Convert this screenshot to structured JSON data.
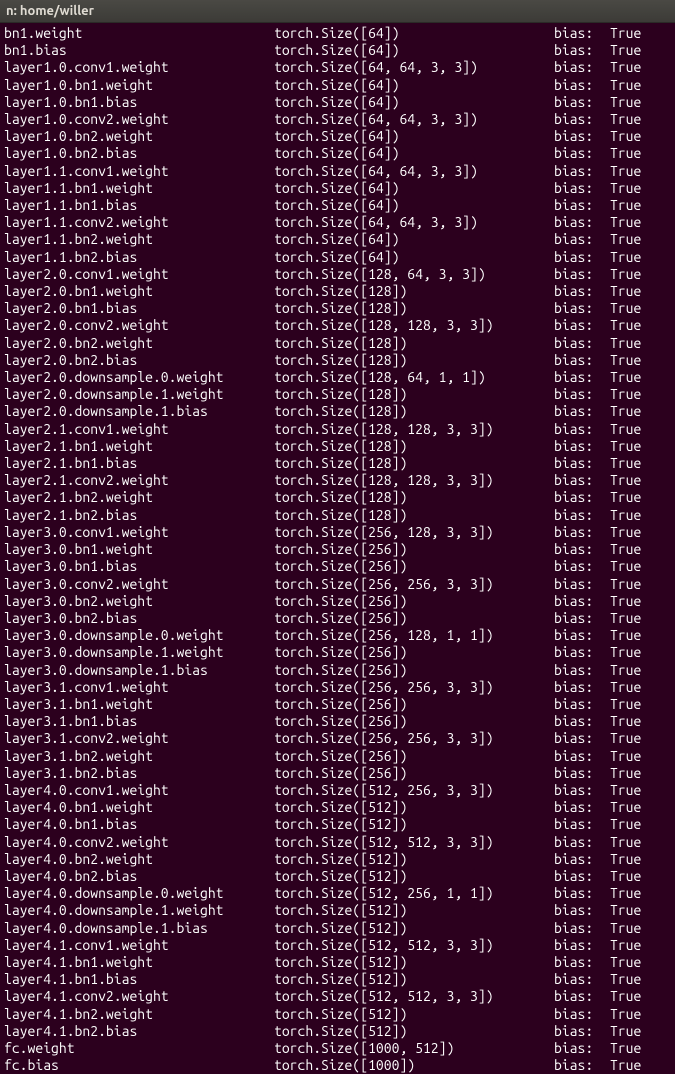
{
  "titlebar": "n: home/willer",
  "rows": [
    {
      "name": "bn1.weight",
      "size": "torch.Size([64])",
      "bias_label": "bias:",
      "bias_value": "True"
    },
    {
      "name": "bn1.bias",
      "size": "torch.Size([64])",
      "bias_label": "bias:",
      "bias_value": "True"
    },
    {
      "name": "layer1.0.conv1.weight",
      "size": "torch.Size([64, 64, 3, 3])",
      "bias_label": "bias:",
      "bias_value": "True"
    },
    {
      "name": "layer1.0.bn1.weight",
      "size": "torch.Size([64])",
      "bias_label": "bias:",
      "bias_value": "True"
    },
    {
      "name": "layer1.0.bn1.bias",
      "size": "torch.Size([64])",
      "bias_label": "bias:",
      "bias_value": "True"
    },
    {
      "name": "layer1.0.conv2.weight",
      "size": "torch.Size([64, 64, 3, 3])",
      "bias_label": "bias:",
      "bias_value": "True"
    },
    {
      "name": "layer1.0.bn2.weight",
      "size": "torch.Size([64])",
      "bias_label": "bias:",
      "bias_value": "True"
    },
    {
      "name": "layer1.0.bn2.bias",
      "size": "torch.Size([64])",
      "bias_label": "bias:",
      "bias_value": "True"
    },
    {
      "name": "layer1.1.conv1.weight",
      "size": "torch.Size([64, 64, 3, 3])",
      "bias_label": "bias:",
      "bias_value": "True"
    },
    {
      "name": "layer1.1.bn1.weight",
      "size": "torch.Size([64])",
      "bias_label": "bias:",
      "bias_value": "True"
    },
    {
      "name": "layer1.1.bn1.bias",
      "size": "torch.Size([64])",
      "bias_label": "bias:",
      "bias_value": "True"
    },
    {
      "name": "layer1.1.conv2.weight",
      "size": "torch.Size([64, 64, 3, 3])",
      "bias_label": "bias:",
      "bias_value": "True"
    },
    {
      "name": "layer1.1.bn2.weight",
      "size": "torch.Size([64])",
      "bias_label": "bias:",
      "bias_value": "True"
    },
    {
      "name": "layer1.1.bn2.bias",
      "size": "torch.Size([64])",
      "bias_label": "bias:",
      "bias_value": "True"
    },
    {
      "name": "layer2.0.conv1.weight",
      "size": "torch.Size([128, 64, 3, 3])",
      "bias_label": "bias:",
      "bias_value": "True"
    },
    {
      "name": "layer2.0.bn1.weight",
      "size": "torch.Size([128])",
      "bias_label": "bias:",
      "bias_value": "True"
    },
    {
      "name": "layer2.0.bn1.bias",
      "size": "torch.Size([128])",
      "bias_label": "bias:",
      "bias_value": "True"
    },
    {
      "name": "layer2.0.conv2.weight",
      "size": "torch.Size([128, 128, 3, 3])",
      "bias_label": "bias:",
      "bias_value": "True"
    },
    {
      "name": "layer2.0.bn2.weight",
      "size": "torch.Size([128])",
      "bias_label": "bias:",
      "bias_value": "True"
    },
    {
      "name": "layer2.0.bn2.bias",
      "size": "torch.Size([128])",
      "bias_label": "bias:",
      "bias_value": "True"
    },
    {
      "name": "layer2.0.downsample.0.weight",
      "size": "torch.Size([128, 64, 1, 1])",
      "bias_label": "bias:",
      "bias_value": "True"
    },
    {
      "name": "layer2.0.downsample.1.weight",
      "size": "torch.Size([128])",
      "bias_label": "bias:",
      "bias_value": "True"
    },
    {
      "name": "layer2.0.downsample.1.bias",
      "size": "torch.Size([128])",
      "bias_label": "bias:",
      "bias_value": "True"
    },
    {
      "name": "layer2.1.conv1.weight",
      "size": "torch.Size([128, 128, 3, 3])",
      "bias_label": "bias:",
      "bias_value": "True"
    },
    {
      "name": "layer2.1.bn1.weight",
      "size": "torch.Size([128])",
      "bias_label": "bias:",
      "bias_value": "True"
    },
    {
      "name": "layer2.1.bn1.bias",
      "size": "torch.Size([128])",
      "bias_label": "bias:",
      "bias_value": "True"
    },
    {
      "name": "layer2.1.conv2.weight",
      "size": "torch.Size([128, 128, 3, 3])",
      "bias_label": "bias:",
      "bias_value": "True"
    },
    {
      "name": "layer2.1.bn2.weight",
      "size": "torch.Size([128])",
      "bias_label": "bias:",
      "bias_value": "True"
    },
    {
      "name": "layer2.1.bn2.bias",
      "size": "torch.Size([128])",
      "bias_label": "bias:",
      "bias_value": "True"
    },
    {
      "name": "layer3.0.conv1.weight",
      "size": "torch.Size([256, 128, 3, 3])",
      "bias_label": "bias:",
      "bias_value": "True"
    },
    {
      "name": "layer3.0.bn1.weight",
      "size": "torch.Size([256])",
      "bias_label": "bias:",
      "bias_value": "True"
    },
    {
      "name": "layer3.0.bn1.bias",
      "size": "torch.Size([256])",
      "bias_label": "bias:",
      "bias_value": "True"
    },
    {
      "name": "layer3.0.conv2.weight",
      "size": "torch.Size([256, 256, 3, 3])",
      "bias_label": "bias:",
      "bias_value": "True"
    },
    {
      "name": "layer3.0.bn2.weight",
      "size": "torch.Size([256])",
      "bias_label": "bias:",
      "bias_value": "True"
    },
    {
      "name": "layer3.0.bn2.bias",
      "size": "torch.Size([256])",
      "bias_label": "bias:",
      "bias_value": "True"
    },
    {
      "name": "layer3.0.downsample.0.weight",
      "size": "torch.Size([256, 128, 1, 1])",
      "bias_label": "bias:",
      "bias_value": "True"
    },
    {
      "name": "layer3.0.downsample.1.weight",
      "size": "torch.Size([256])",
      "bias_label": "bias:",
      "bias_value": "True"
    },
    {
      "name": "layer3.0.downsample.1.bias",
      "size": "torch.Size([256])",
      "bias_label": "bias:",
      "bias_value": "True"
    },
    {
      "name": "layer3.1.conv1.weight",
      "size": "torch.Size([256, 256, 3, 3])",
      "bias_label": "bias:",
      "bias_value": "True"
    },
    {
      "name": "layer3.1.bn1.weight",
      "size": "torch.Size([256])",
      "bias_label": "bias:",
      "bias_value": "True"
    },
    {
      "name": "layer3.1.bn1.bias",
      "size": "torch.Size([256])",
      "bias_label": "bias:",
      "bias_value": "True"
    },
    {
      "name": "layer3.1.conv2.weight",
      "size": "torch.Size([256, 256, 3, 3])",
      "bias_label": "bias:",
      "bias_value": "True"
    },
    {
      "name": "layer3.1.bn2.weight",
      "size": "torch.Size([256])",
      "bias_label": "bias:",
      "bias_value": "True"
    },
    {
      "name": "layer3.1.bn2.bias",
      "size": "torch.Size([256])",
      "bias_label": "bias:",
      "bias_value": "True"
    },
    {
      "name": "layer4.0.conv1.weight",
      "size": "torch.Size([512, 256, 3, 3])",
      "bias_label": "bias:",
      "bias_value": "True"
    },
    {
      "name": "layer4.0.bn1.weight",
      "size": "torch.Size([512])",
      "bias_label": "bias:",
      "bias_value": "True"
    },
    {
      "name": "layer4.0.bn1.bias",
      "size": "torch.Size([512])",
      "bias_label": "bias:",
      "bias_value": "True"
    },
    {
      "name": "layer4.0.conv2.weight",
      "size": "torch.Size([512, 512, 3, 3])",
      "bias_label": "bias:",
      "bias_value": "True"
    },
    {
      "name": "layer4.0.bn2.weight",
      "size": "torch.Size([512])",
      "bias_label": "bias:",
      "bias_value": "True"
    },
    {
      "name": "layer4.0.bn2.bias",
      "size": "torch.Size([512])",
      "bias_label": "bias:",
      "bias_value": "True"
    },
    {
      "name": "layer4.0.downsample.0.weight",
      "size": "torch.Size([512, 256, 1, 1])",
      "bias_label": "bias:",
      "bias_value": "True"
    },
    {
      "name": "layer4.0.downsample.1.weight",
      "size": "torch.Size([512])",
      "bias_label": "bias:",
      "bias_value": "True"
    },
    {
      "name": "layer4.0.downsample.1.bias",
      "size": "torch.Size([512])",
      "bias_label": "bias:",
      "bias_value": "True"
    },
    {
      "name": "layer4.1.conv1.weight",
      "size": "torch.Size([512, 512, 3, 3])",
      "bias_label": "bias:",
      "bias_value": "True"
    },
    {
      "name": "layer4.1.bn1.weight",
      "size": "torch.Size([512])",
      "bias_label": "bias:",
      "bias_value": "True"
    },
    {
      "name": "layer4.1.bn1.bias",
      "size": "torch.Size([512])",
      "bias_label": "bias:",
      "bias_value": "True"
    },
    {
      "name": "layer4.1.conv2.weight",
      "size": "torch.Size([512, 512, 3, 3])",
      "bias_label": "bias:",
      "bias_value": "True"
    },
    {
      "name": "layer4.1.bn2.weight",
      "size": "torch.Size([512])",
      "bias_label": "bias:",
      "bias_value": "True"
    },
    {
      "name": "layer4.1.bn2.bias",
      "size": "torch.Size([512])",
      "bias_label": "bias:",
      "bias_value": "True"
    },
    {
      "name": "fc.weight",
      "size": "torch.Size([1000, 512])",
      "bias_label": "bias:",
      "bias_value": "True"
    },
    {
      "name": "fc.bias",
      "size": "torch.Size([1000])",
      "bias_label": "bias:",
      "bias_value": "True"
    }
  ]
}
